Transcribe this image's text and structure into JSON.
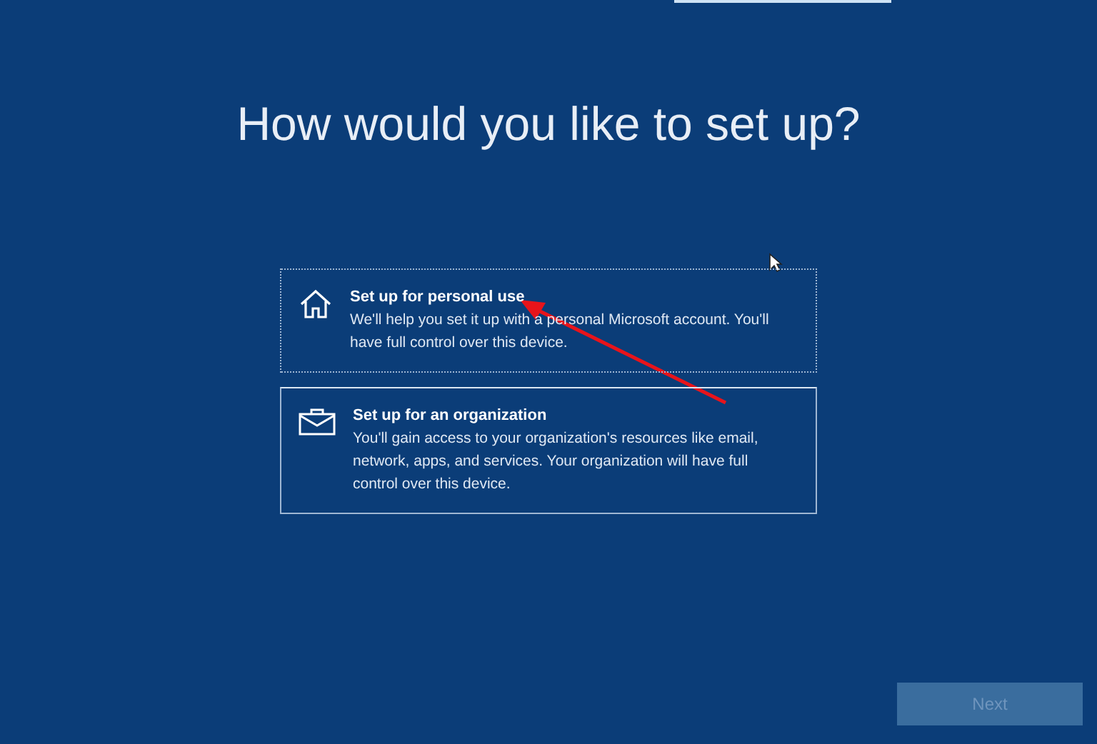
{
  "title": "How would you like to set up?",
  "options": [
    {
      "kind": "home",
      "heading": "Set up for personal use",
      "description": "We'll help you set it up with a personal Microsoft account. You'll have full control over this device."
    },
    {
      "kind": "briefcase",
      "heading": "Set up for an organization",
      "description": "You'll gain access to your organization's resources like email, network, apps, and services. Your organization will have full control over this device."
    }
  ],
  "next_button": {
    "label": "Next",
    "disabled": true
  }
}
